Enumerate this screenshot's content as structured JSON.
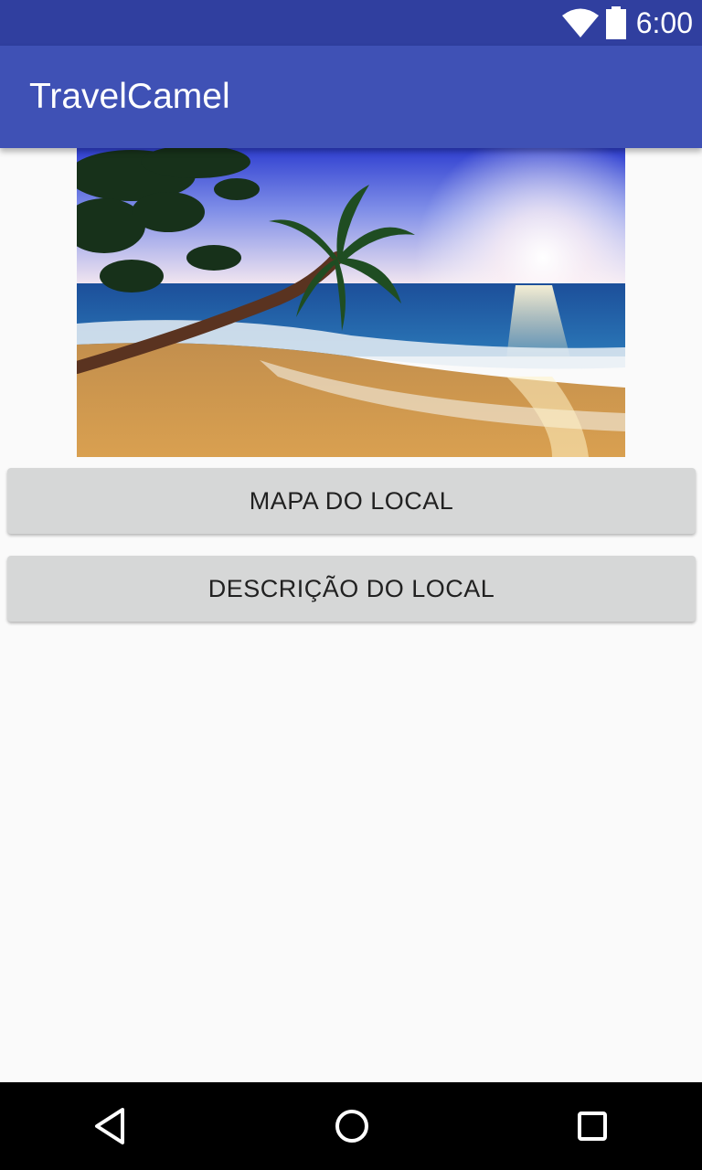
{
  "status_bar": {
    "time": "6:00",
    "icons": [
      "wifi-icon",
      "battery-icon"
    ],
    "color": "#303f9f"
  },
  "app_bar": {
    "title": "TravelCamel",
    "color": "#3f51b5"
  },
  "hero_image": {
    "description_icon": "beach-palm-sunset-image"
  },
  "buttons": {
    "map_label": "MAPA DO LOCAL",
    "description_label": "DESCRIÇÃO DO LOCAL"
  },
  "nav_bar": {
    "icons": [
      "back-icon",
      "home-icon",
      "recents-icon"
    ]
  }
}
